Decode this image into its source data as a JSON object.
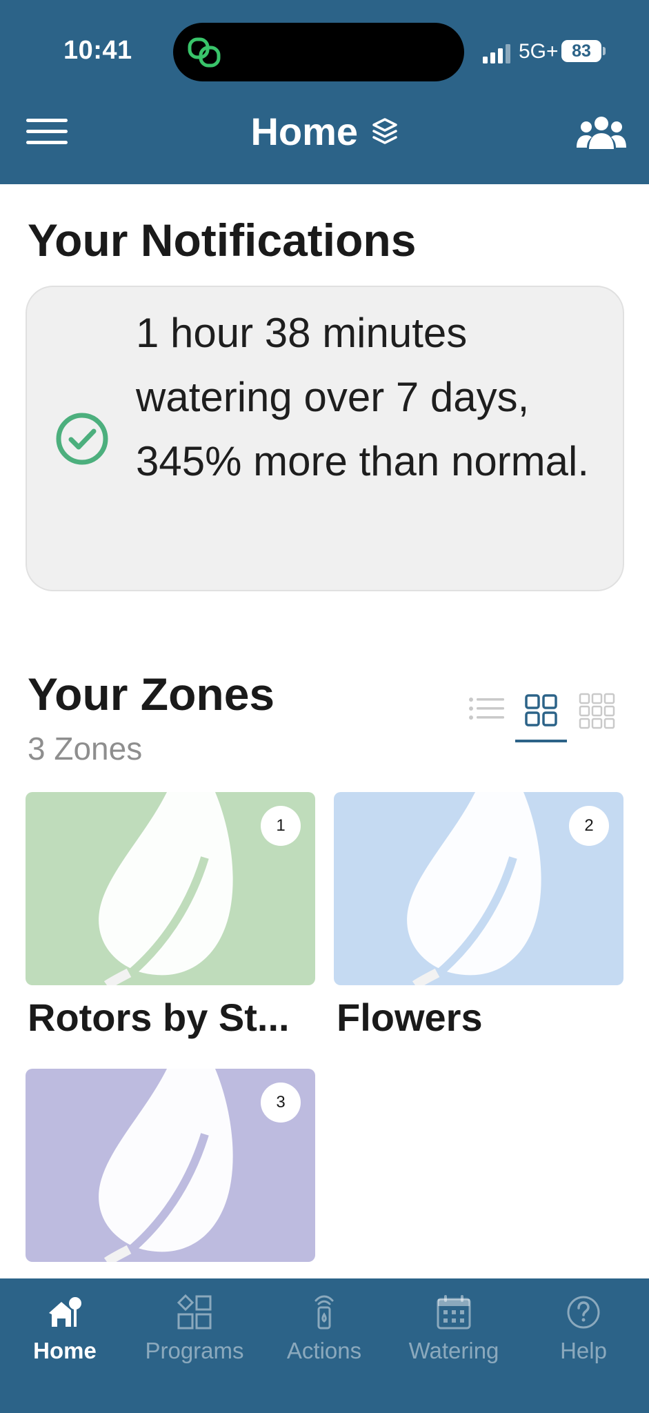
{
  "status_bar": {
    "time": "10:41",
    "network": "5G+",
    "battery": "83"
  },
  "header": {
    "title": "Home"
  },
  "notifications": {
    "heading": "Your Notifications",
    "message": "1 hour 38 minutes watering over 7 days, 345% more than normal.",
    "icon": "check-circle-icon"
  },
  "zones": {
    "heading": "Your Zones",
    "count_label": "3 Zones",
    "view_modes": [
      "list",
      "grid",
      "compact-grid"
    ],
    "active_view": "grid",
    "items": [
      {
        "number": "1",
        "name": "Rotors by  St...",
        "color": "#bfdcbb"
      },
      {
        "number": "2",
        "name": "Flowers",
        "color": "#c5daf2"
      },
      {
        "number": "3",
        "name": "",
        "color": "#bdbbdf"
      }
    ]
  },
  "tabbar": {
    "tabs": [
      {
        "label": "Home",
        "icon": "home-icon",
        "active": true
      },
      {
        "label": "Programs",
        "icon": "programs-icon",
        "active": false
      },
      {
        "label": "Actions",
        "icon": "actions-icon",
        "active": false
      },
      {
        "label": "Watering",
        "icon": "calendar-icon",
        "active": false
      },
      {
        "label": "Help",
        "icon": "help-icon",
        "active": false
      }
    ]
  },
  "colors": {
    "primary": "#2c6388",
    "success": "#4caf7d",
    "card_bg": "#f0f0f0"
  }
}
